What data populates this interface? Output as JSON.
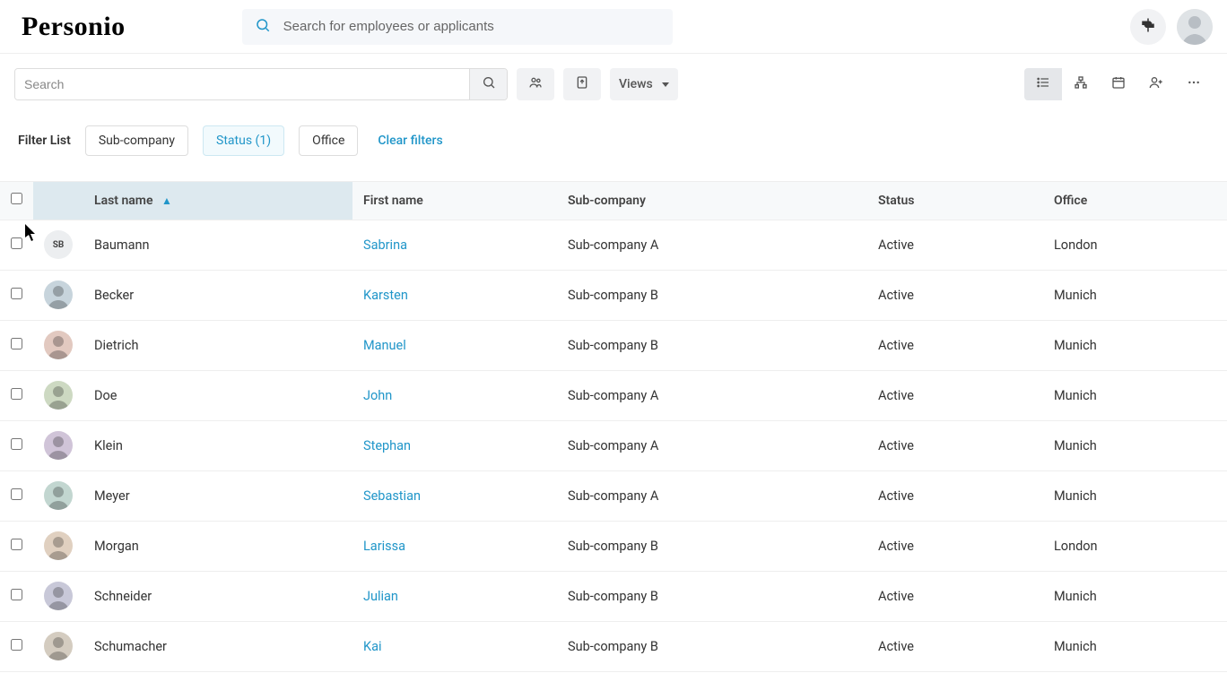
{
  "header": {
    "logo_text": "Personio",
    "global_search_placeholder": "Search for employees or applicants"
  },
  "toolbar": {
    "search_placeholder": "Search",
    "views_label": "Views"
  },
  "filters": {
    "label": "Filter List",
    "subcompany_label": "Sub-company",
    "status_label": "Status (1)",
    "office_label": "Office",
    "clear_label": "Clear filters"
  },
  "table": {
    "columns": {
      "last_name": "Last name",
      "first_name": "First name",
      "sub_company": "Sub-company",
      "status": "Status",
      "office": "Office"
    },
    "rows": [
      {
        "initials": "SB",
        "avatar_kind": "initials",
        "last": "Baumann",
        "first": "Sabrina",
        "sub": "Sub-company A",
        "status": "Active",
        "office": "London"
      },
      {
        "initials": "",
        "avatar_kind": "photo",
        "last": "Becker",
        "first": "Karsten",
        "sub": "Sub-company B",
        "status": "Active",
        "office": "Munich"
      },
      {
        "initials": "",
        "avatar_kind": "photo",
        "last": "Dietrich",
        "first": "Manuel",
        "sub": "Sub-company B",
        "status": "Active",
        "office": "Munich"
      },
      {
        "initials": "",
        "avatar_kind": "photo",
        "last": "Doe",
        "first": "John",
        "sub": "Sub-company A",
        "status": "Active",
        "office": "Munich"
      },
      {
        "initials": "",
        "avatar_kind": "photo",
        "last": "Klein",
        "first": "Stephan",
        "sub": "Sub-company A",
        "status": "Active",
        "office": "Munich"
      },
      {
        "initials": "",
        "avatar_kind": "photo",
        "last": "Meyer",
        "first": "Sebastian",
        "sub": "Sub-company A",
        "status": "Active",
        "office": "Munich"
      },
      {
        "initials": "",
        "avatar_kind": "photo",
        "last": "Morgan",
        "first": "Larissa",
        "sub": "Sub-company B",
        "status": "Active",
        "office": "London"
      },
      {
        "initials": "",
        "avatar_kind": "photo",
        "last": "Schneider",
        "first": "Julian",
        "sub": "Sub-company B",
        "status": "Active",
        "office": "Munich"
      },
      {
        "initials": "",
        "avatar_kind": "photo",
        "last": "Schumacher",
        "first": "Kai",
        "sub": "Sub-company B",
        "status": "Active",
        "office": "Munich"
      }
    ]
  }
}
